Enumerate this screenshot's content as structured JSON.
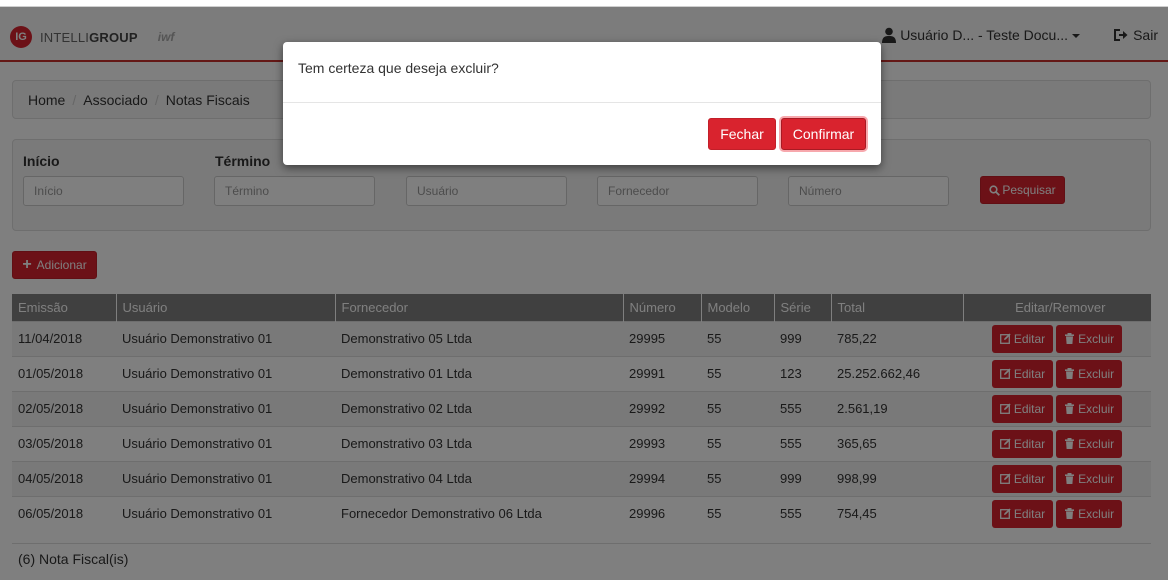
{
  "brand": {
    "badge": "IG",
    "name_light": "INTELLI",
    "name_bold": "GROUP",
    "mark": "iwf",
    "accent_color": "#d9232e"
  },
  "navbar": {
    "user_label": "Usuário D... - Teste Docu...",
    "user_icon": "user-icon",
    "logout_label": "Sair",
    "logout_icon": "sign-out-icon"
  },
  "breadcrumb": [
    "Home",
    "Associado",
    "Notas Fiscais"
  ],
  "filters": {
    "start_label": "Início",
    "end_label": "Término",
    "start_placeholder": "Início",
    "end_placeholder": "Término",
    "user_placeholder": "Usuário",
    "supplier_placeholder": "Fornecedor",
    "number_placeholder": "Número",
    "search_label": "Pesquisar",
    "search_icon": "search-icon"
  },
  "add_button": {
    "label": "Adicionar",
    "icon": "plus-icon"
  },
  "table": {
    "headers": [
      "Emissão",
      "Usuário",
      "Fornecedor",
      "Número",
      "Modelo",
      "Série",
      "Total",
      "Editar/Remover"
    ],
    "edit_label": "Editar",
    "delete_label": "Excluir",
    "rows": [
      [
        "11/04/2018",
        "Usuário Demonstrativo 01",
        "Demonstrativo 05 Ltda",
        "29995",
        "55",
        "999",
        "785,22"
      ],
      [
        "01/05/2018",
        "Usuário Demonstrativo 01",
        "Demonstrativo 01 Ltda",
        "29991",
        "55",
        "123",
        "25.252.662,46"
      ],
      [
        "02/05/2018",
        "Usuário Demonstrativo 01",
        "Demonstrativo 02 Ltda",
        "29992",
        "55",
        "555",
        "2.561,19"
      ],
      [
        "03/05/2018",
        "Usuário Demonstrativo 01",
        "Demonstrativo 03 Ltda",
        "29993",
        "55",
        "555",
        "365,65"
      ],
      [
        "04/05/2018",
        "Usuário Demonstrativo 01",
        "Demonstrativo 04 Ltda",
        "29994",
        "55",
        "999",
        "998,99"
      ],
      [
        "06/05/2018",
        "Usuário Demonstrativo 01",
        "Fornecedor Demonstrativo 06 Ltda",
        "29996",
        "55",
        "555",
        "754,45"
      ]
    ],
    "count_text": "(6) Nota Fiscal(is)"
  },
  "modal": {
    "message": "Tem certeza que deseja excluir?",
    "close_label": "Fechar",
    "confirm_label": "Confirmar"
  }
}
